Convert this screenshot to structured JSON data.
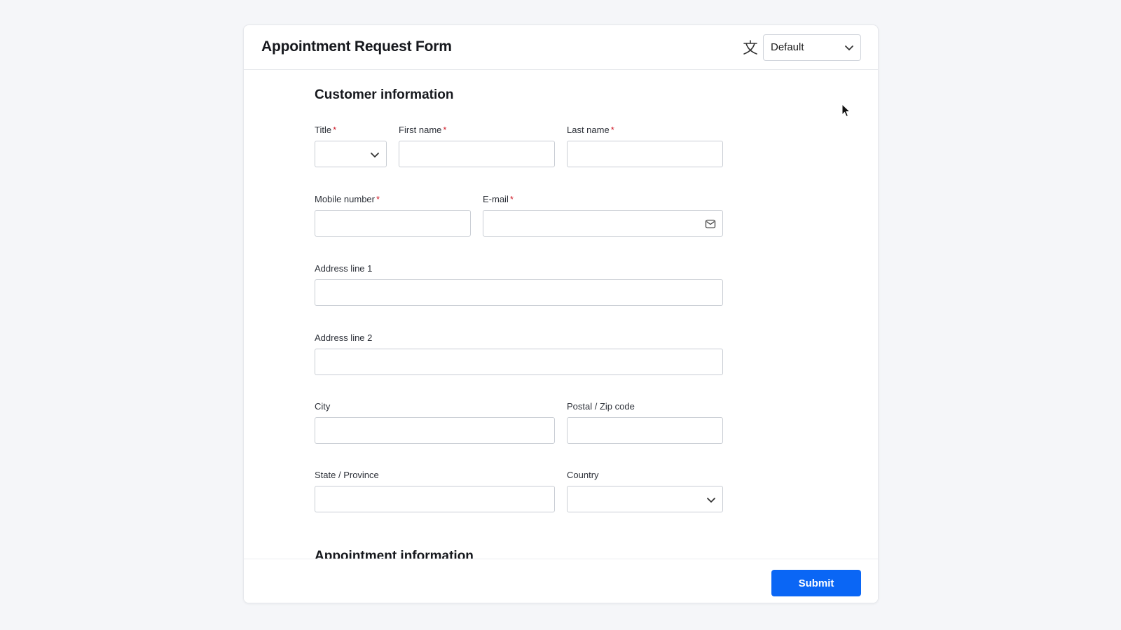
{
  "form": {
    "title": "Appointment Request Form",
    "language_select": {
      "value": "Default",
      "icon": "translate-icon"
    }
  },
  "customer_section": {
    "title": "Customer information",
    "fields": {
      "title": {
        "label": "Title",
        "required_mark": "*",
        "value": ""
      },
      "first_name": {
        "label": "First name",
        "required_mark": "*",
        "value": ""
      },
      "last_name": {
        "label": "Last name",
        "required_mark": "*",
        "value": ""
      },
      "mobile": {
        "label": "Mobile number",
        "required_mark": "*",
        "value": ""
      },
      "email": {
        "label": "E-mail",
        "required_mark": "*",
        "value": "",
        "icon": "envelope-icon"
      },
      "address1": {
        "label": "Address line 1",
        "value": ""
      },
      "address2": {
        "label": "Address line 2",
        "value": ""
      },
      "city": {
        "label": "City",
        "value": ""
      },
      "postal": {
        "label": "Postal / Zip code",
        "value": ""
      },
      "state": {
        "label": "State / Province",
        "value": ""
      },
      "country": {
        "label": "Country",
        "value": ""
      }
    }
  },
  "appointment_section": {
    "title": "Appointment information"
  },
  "footer": {
    "submit_label": "Submit"
  },
  "colors": {
    "accent": "#0a66f5",
    "required": "#d0212e",
    "background": "#f5f6f9"
  }
}
